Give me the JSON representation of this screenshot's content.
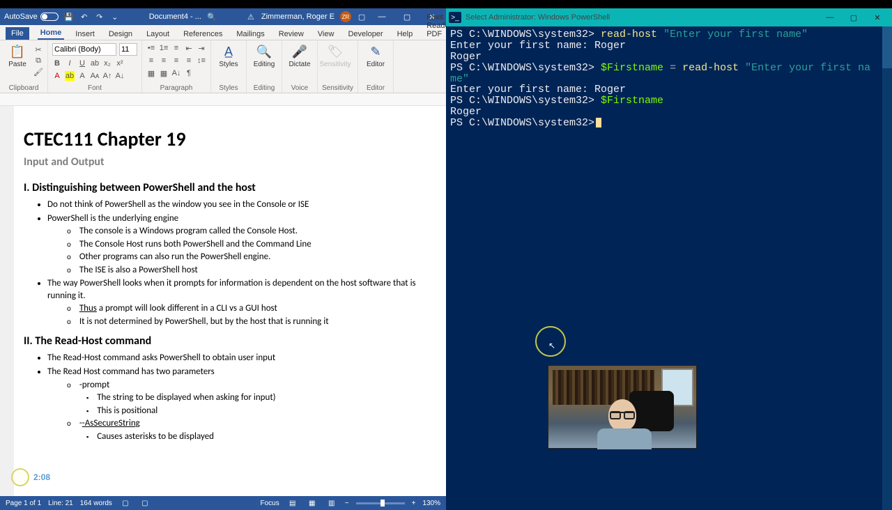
{
  "word": {
    "titlebar": {
      "autosave_label": "AutoSave",
      "doc_name": "Document4 - ...",
      "user": "Zimmerman, Roger E",
      "user_initials": "ZR"
    },
    "tabs": {
      "file": "File",
      "items": [
        "Home",
        "Insert",
        "Design",
        "Layout",
        "References",
        "Mailings",
        "Review",
        "View",
        "Developer",
        "Help",
        "Foxit Reader PDF"
      ]
    },
    "ribbon": {
      "clipboard": {
        "name": "Clipboard",
        "paste": "Paste"
      },
      "font": {
        "name": "Font",
        "family": "Calibri (Body)",
        "size": "11"
      },
      "paragraph": {
        "name": "Paragraph"
      },
      "styles": {
        "name": "Styles",
        "btn": "Styles"
      },
      "editing": {
        "name": "Editing",
        "btn": "Editing"
      },
      "voice": {
        "name": "Voice",
        "btn": "Dictate"
      },
      "sensitivity": {
        "name": "Sensitivity",
        "btn": "Sensitivity"
      },
      "editor": {
        "name": "Editor",
        "btn": "Editor"
      }
    },
    "document": {
      "title": "CTEC111 Chapter 19",
      "subtitle": "Input and Output",
      "s1_heading": "I. Distinguishing between PowerShell and the host",
      "s1": {
        "b1": "Do not think of PowerShell as the window you see in the Console or ISE",
        "b2": "PowerShell is the underlying engine",
        "b2a": "The console is a Windows program called the Console Host.",
        "b2b": "The Console Host runs both PowerShell and the Command Line",
        "b2c": "Other programs can also run the PowerShell engine.",
        "b2d": "The ISE is also a PowerShell host",
        "b3": "The way PowerShell looks when it prompts for information is dependent on the host software that is running it.",
        "b3a_pre": "Thus",
        "b3a_post": " a prompt will look different in a CLI vs a GUI host",
        "b3b": "It is not determined by PowerShell, but by the host that is running it"
      },
      "s2_heading": "II. The Read-Host command",
      "s2": {
        "b1": "The Read-Host command asks PowerShell to obtain user input",
        "b2": "The Read Host command has two parameters",
        "b2a": "-prompt",
        "b2a1": "The string to be displayed when asking for input)",
        "b2a2": "This is positional",
        "b2b": "-AsSecureString",
        "b2b1": "Causes asterisks to be displayed"
      }
    },
    "status": {
      "page": "Page 1 of 1",
      "line": "Line: 21",
      "words": "164 words",
      "focus": "Focus",
      "zoom": "130%"
    }
  },
  "powershell": {
    "title": "Select Administrator: Windows PowerShell",
    "lines": {
      "l1_prompt": "PS C:\\WINDOWS\\system32> ",
      "l1_cmd": "read-host ",
      "l1_str": "\"Enter your first name\"",
      "l2": "Enter your first name: Roger",
      "l3": "Roger",
      "l4_prompt": "PS C:\\WINDOWS\\system32> ",
      "l4_var": "$Firstname ",
      "l4_op": "= ",
      "l4_cmd": "read-host ",
      "l4_str": "\"Enter your first na",
      "l4b_str": "me\"",
      "l5": "Enter your first name: Roger",
      "l6_prompt": "PS C:\\WINDOWS\\system32> ",
      "l6_var": "$Firstname",
      "l7": "Roger",
      "l8_prompt": "PS C:\\WINDOWS\\system32>"
    }
  },
  "overlay": {
    "timestamp": "2:08"
  }
}
